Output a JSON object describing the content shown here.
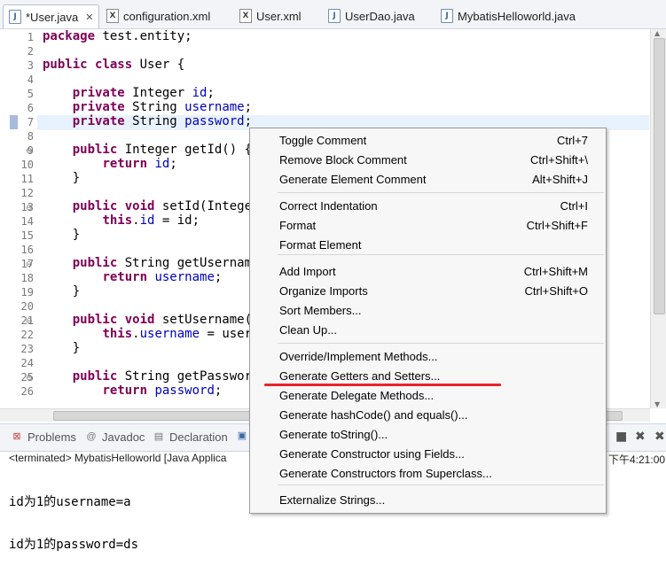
{
  "tabs": [
    {
      "label": "*User.java",
      "icon": "java-file-icon",
      "active": true
    },
    {
      "label": "configuration.xml",
      "icon": "xml-file-icon"
    },
    {
      "label": "User.xml",
      "icon": "xml-file-icon"
    },
    {
      "label": "UserDao.java",
      "icon": "java-file-icon"
    },
    {
      "label": "MybatisHelloworld.java",
      "icon": "java-file-icon"
    }
  ],
  "tab_close_glyph": "✕",
  "editor": {
    "line_numbers": [
      "1",
      "2",
      "3",
      "4",
      "5",
      "6",
      "7",
      "8",
      "9",
      "10",
      "11",
      "12",
      "13",
      "14",
      "15",
      "16",
      "17",
      "18",
      "19",
      "20",
      "21",
      "22",
      "23",
      "24",
      "25",
      "26"
    ],
    "lines": [
      "package test.entity;",
      "",
      "public class User {",
      "",
      "    private Integer id;",
      "    private String username;",
      "    private String password;",
      "",
      "    public Integer getId() {",
      "        return id;",
      "    }",
      "",
      "    public void setId(Intege",
      "        this.id = id;",
      "    }",
      "",
      "    public String getUsernam",
      "        return username;",
      "    }",
      "",
      "    public void setUsername(",
      "        this.username = user",
      "    }",
      "",
      "    public String getPasswor",
      "        return password;"
    ]
  },
  "views": {
    "problems": "Problems",
    "javadoc": "Javadoc",
    "declaration": "Declaration",
    "console_head": "<terminated> MybatisHelloworld [Java Applica",
    "time": "下午4:21:00",
    "output": [
      "id为1的username=a",
      "id为1的password=ds"
    ]
  },
  "menu": {
    "items": [
      {
        "label": "Toggle Comment",
        "shortcut": "Ctrl+7"
      },
      {
        "label": "Remove Block Comment",
        "shortcut": "Ctrl+Shift+\\"
      },
      {
        "label": "Generate Element Comment",
        "shortcut": "Alt+Shift+J"
      },
      {
        "label": "Correct Indentation",
        "shortcut": "Ctrl+I"
      },
      {
        "label": "Format",
        "shortcut": "Ctrl+Shift+F"
      },
      {
        "label": "Format Element",
        "shortcut": ""
      },
      {
        "label": "Add Import",
        "shortcut": "Ctrl+Shift+M"
      },
      {
        "label": "Organize Imports",
        "shortcut": "Ctrl+Shift+O"
      },
      {
        "label": "Sort Members...",
        "shortcut": ""
      },
      {
        "label": "Clean Up...",
        "shortcut": ""
      },
      {
        "label": "Override/Implement Methods...",
        "shortcut": ""
      },
      {
        "label": "Generate Getters and Setters...",
        "shortcut": ""
      },
      {
        "label": "Generate Delegate Methods...",
        "shortcut": ""
      },
      {
        "label": "Generate hashCode() and equals()...",
        "shortcut": ""
      },
      {
        "label": "Generate toString()...",
        "shortcut": ""
      },
      {
        "label": "Generate Constructor using Fields...",
        "shortcut": ""
      },
      {
        "label": "Generate Constructors from Superclass...",
        "shortcut": ""
      },
      {
        "label": "Externalize Strings...",
        "shortcut": ""
      }
    ]
  },
  "colors": {
    "keyword": "#7f0055",
    "field": "#0000c0",
    "highlight_underline": "#e8242a"
  }
}
